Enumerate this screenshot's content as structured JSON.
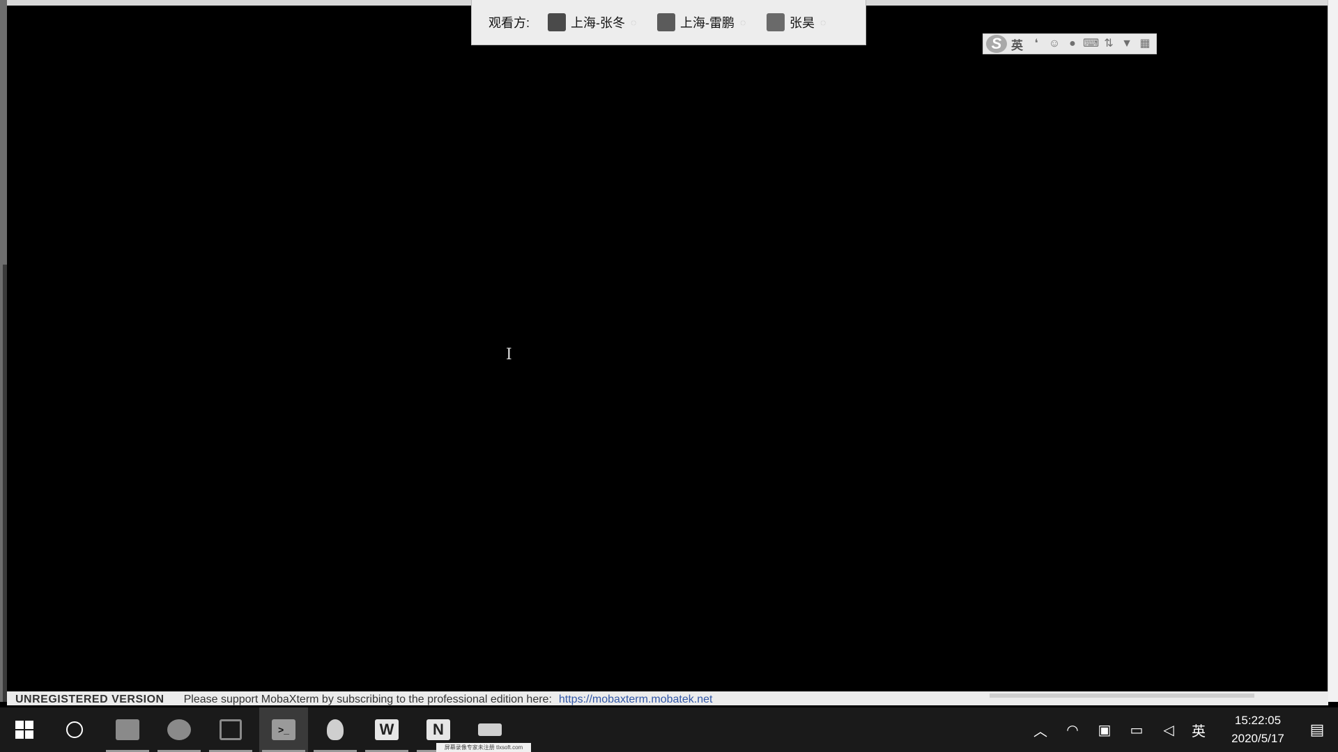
{
  "viewers": {
    "label": "观看方:",
    "list": [
      {
        "name": "上海-张冬",
        "avatar_color": "#4a4a4a"
      },
      {
        "name": "上海-雷鹏",
        "avatar_color": "#5b5b5b"
      },
      {
        "name": "张昊",
        "avatar_color": "#6a6a6a"
      }
    ]
  },
  "ime": {
    "logo": "S",
    "lang": "英",
    "icons": [
      "punctuation-icon",
      "emoji-icon",
      "microphone-icon",
      "keyboard-icon",
      "sync-icon",
      "skin-icon",
      "grid-icon"
    ]
  },
  "status_bar": {
    "unregistered": "UNREGISTERED VERSION",
    "message": "Please support MobaXterm by subscribing to the professional edition here:",
    "link": "https://mobaxterm.mobatek.net"
  },
  "taskbar": {
    "apps": [
      {
        "name": "file-explorer-icon",
        "color": "#8a8a8a"
      },
      {
        "name": "firefox-icon",
        "color": "#8a8a8a"
      },
      {
        "name": "task-view-icon",
        "color": "#8a8a8a"
      },
      {
        "name": "mobaxterm-icon",
        "color": "#9a9a9a"
      },
      {
        "name": "qq-icon",
        "color": "#cfcfcf"
      },
      {
        "name": "word-icon",
        "label": "W",
        "color": "#e6e6e6"
      },
      {
        "name": "onenote-icon",
        "label": "N",
        "color": "#e6e6e6"
      },
      {
        "name": "recorder-icon",
        "color": "#cfcfcf"
      }
    ],
    "watermark": "屏幕录像专家未注册 tlxsoft.com",
    "tray": {
      "lang": "英",
      "time": "15:22:05",
      "date": "2020/5/17"
    }
  },
  "colors": {
    "taskbar_bg": "#1a1a1a",
    "terminal_bg": "#000000",
    "link": "#3056a6"
  }
}
